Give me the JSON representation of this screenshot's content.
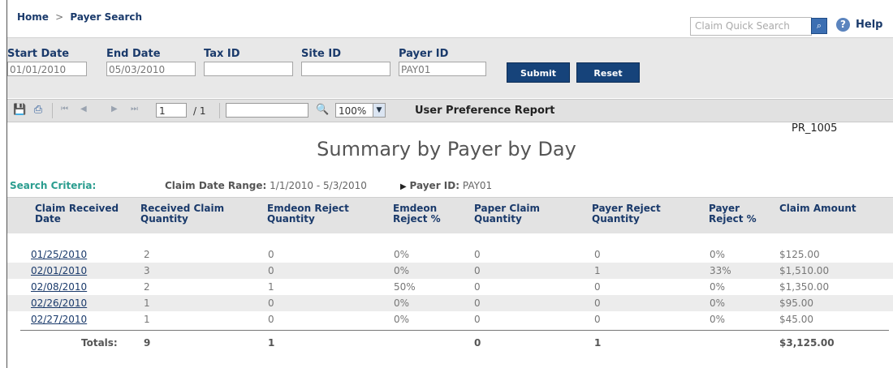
{
  "header": {
    "breadcrumb_home": "Home",
    "breadcrumb_sep": ">",
    "breadcrumb_current": "Payer Search",
    "quick_search_placeholder": "Claim Quick Search",
    "help_label": "Help"
  },
  "filters": {
    "start_date": {
      "label": "Start Date",
      "value": "01/01/2010"
    },
    "end_date": {
      "label": "End Date",
      "value": "05/03/2010"
    },
    "tax_id": {
      "label": "Tax ID",
      "value": ""
    },
    "site_id": {
      "label": "Site ID",
      "value": ""
    },
    "payer_id": {
      "label": "Payer ID",
      "value": "PAY01"
    },
    "submit_label": "Submit",
    "reset_label": "Reset"
  },
  "toolbar": {
    "page_current": "1",
    "page_total": "/ 1",
    "zoom": "100%",
    "report_name": "User Preference Report"
  },
  "report": {
    "id": "PR_1005",
    "title": "Summary by Payer by Day",
    "criteria_heading": "Search Criteria:",
    "date_range_label": "Claim Date Range:",
    "date_range_value": "1/1/2010 - 5/3/2010",
    "payer_label": "Payer ID:",
    "payer_value": "PAY01"
  },
  "table": {
    "headers": [
      {
        "line1": "Claim Received",
        "line2": "Date"
      },
      {
        "line1": "Received Claim",
        "line2": "Quantity"
      },
      {
        "line1": "Emdeon Reject",
        "line2": "Quantity"
      },
      {
        "line1": "Emdeon",
        "line2": "Reject %"
      },
      {
        "line1": "Paper Claim",
        "line2": "Quantity"
      },
      {
        "line1": "Payer Reject",
        "line2": "Quantity"
      },
      {
        "line1": "Payer",
        "line2": "Reject %"
      },
      {
        "line1": "Claim Amount",
        "line2": ""
      }
    ],
    "rows": [
      [
        "01/25/2010",
        "2",
        "0",
        "0%",
        "0",
        "0",
        "0%",
        "$125.00"
      ],
      [
        "02/01/2010",
        "3",
        "0",
        "0%",
        "0",
        "1",
        "33%",
        "$1,510.00"
      ],
      [
        "02/08/2010",
        "2",
        "1",
        "50%",
        "0",
        "0",
        "0%",
        "$1,350.00"
      ],
      [
        "02/26/2010",
        "1",
        "0",
        "0%",
        "0",
        "0",
        "0%",
        "$95.00"
      ],
      [
        "02/27/2010",
        "1",
        "0",
        "0%",
        "0",
        "0",
        "0%",
        "$45.00"
      ]
    ],
    "totals": {
      "label": "Totals:",
      "received": "9",
      "emdeon_reject": "1",
      "paper": "0",
      "payer_reject": "1",
      "amount": "$3,125.00"
    }
  }
}
